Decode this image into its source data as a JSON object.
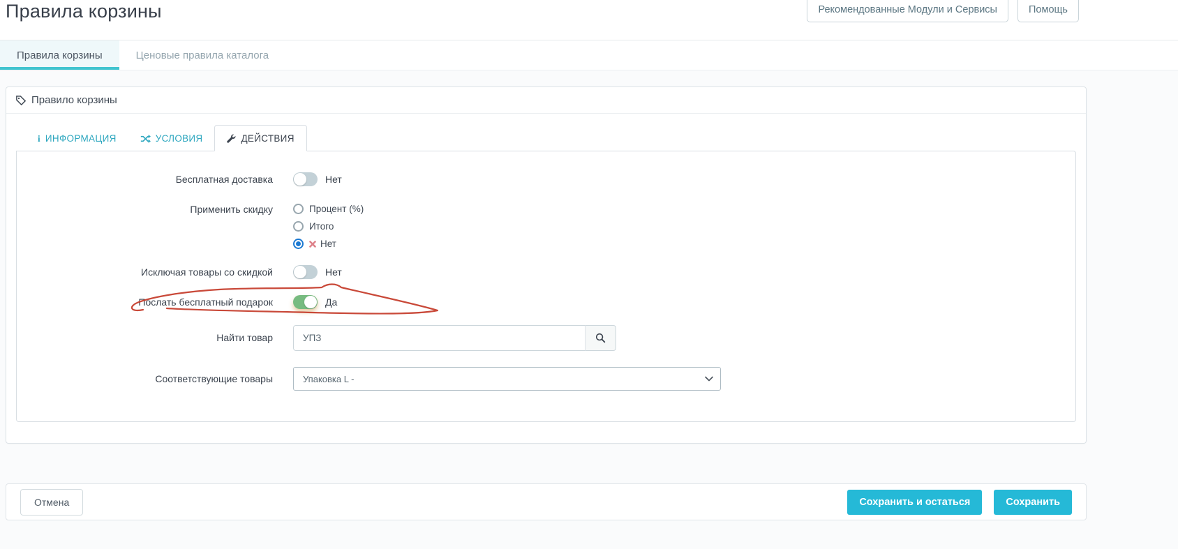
{
  "page": {
    "title": "Правила корзины"
  },
  "header": {
    "modules_button": "Рекомендованные Модули и Сервисы",
    "help_button": "Помощь"
  },
  "nav_tabs": [
    {
      "label": "Правила корзины",
      "active": true
    },
    {
      "label": "Ценовые правила каталога",
      "active": false
    }
  ],
  "panel": {
    "title": "Правило корзины",
    "tabs": [
      {
        "label": "ИНФОРМАЦИЯ",
        "icon": "info-icon",
        "active": false
      },
      {
        "label": "УСЛОВИЯ",
        "icon": "shuffle-icon",
        "active": false
      },
      {
        "label": "ДЕЙСТВИЯ",
        "icon": "wrench-icon",
        "active": true
      }
    ],
    "form": {
      "free_shipping": {
        "label": "Бесплатная доставка",
        "state": "off",
        "state_label": "Нет"
      },
      "apply_discount": {
        "label": "Применить скидку",
        "options": [
          {
            "label": "Процент (%)",
            "checked": false
          },
          {
            "label": "Итого",
            "checked": false
          },
          {
            "label": "Нет",
            "checked": true,
            "icon": "x-icon"
          }
        ]
      },
      "exclude_discounted": {
        "label": "Исключая товары со скидкой",
        "state": "off",
        "state_label": "Нет"
      },
      "free_gift": {
        "label": "Послать бесплатный подарок",
        "state": "on",
        "state_label": "Да",
        "annotated": true
      },
      "product_search": {
        "label": "Найти товар",
        "value": "УПЗ"
      },
      "matching_products": {
        "label": "Соответствующие товары",
        "selected": "Упаковка L -"
      }
    }
  },
  "footer": {
    "cancel": "Отмена",
    "save_and_stay": "Сохранить и остаться",
    "save": "Сохранить"
  },
  "colors": {
    "accent": "#25b9d7",
    "tab_underline": "#40c4cf",
    "toggle_on": "#77bb80",
    "toggle_off": "#c3d1d7",
    "radio_checked": "#1b79d2",
    "annotation_red": "#c43a28"
  }
}
